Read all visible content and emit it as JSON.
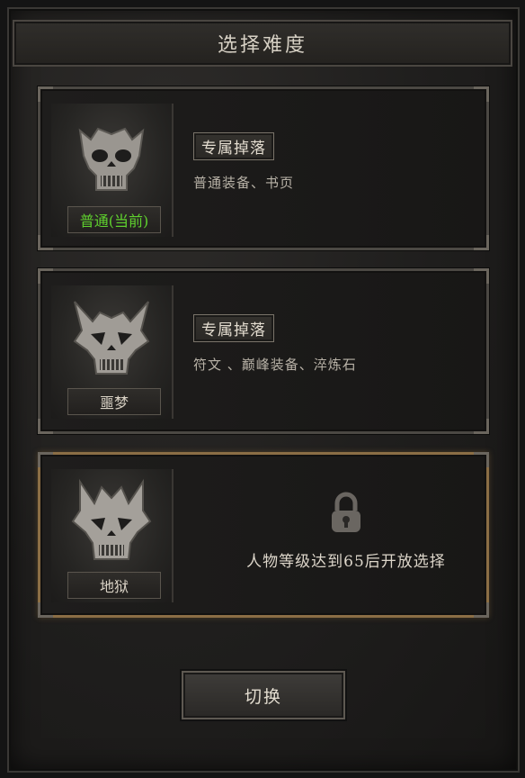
{
  "header": {
    "title": "选择难度"
  },
  "difficulties": [
    {
      "label": "普通(当前)",
      "drop_title": "专属掉落",
      "drops": "普通装备、书页",
      "locked": false,
      "current": true,
      "icon": "skull-normal-icon"
    },
    {
      "label": "噩梦",
      "drop_title": "专属掉落",
      "drops": "符文 、巅峰装备、淬炼石",
      "locked": false,
      "current": false,
      "icon": "skull-nightmare-icon"
    },
    {
      "label": "地狱",
      "lock_message": "人物等级达到65后开放选择",
      "locked": true,
      "current": false,
      "icon": "skull-hell-icon"
    }
  ],
  "footer": {
    "switch_label": "切换"
  },
  "colors": {
    "current_label": "#5fd12e",
    "locked_border": "#8b6e45"
  }
}
